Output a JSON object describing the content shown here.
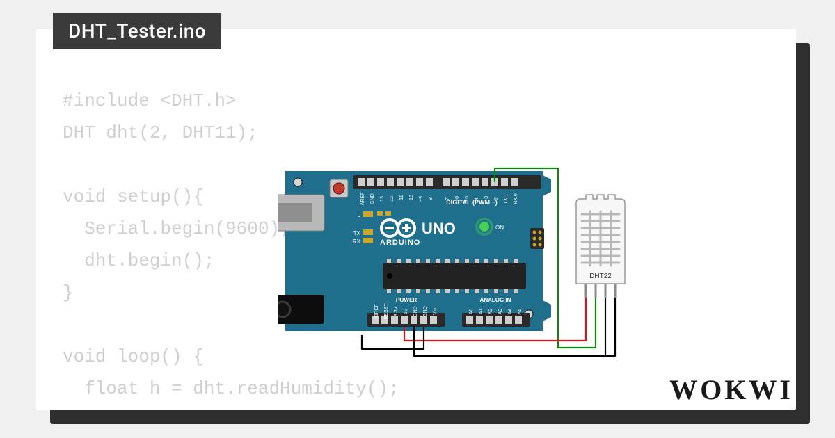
{
  "tab": {
    "filename": "DHT_Tester.ino"
  },
  "code": {
    "lines": [
      "#include <DHT.h>",
      "DHT dht(2, DHT11);",
      "",
      "void setup(){",
      "  Serial.begin(9600);",
      "  dht.begin();",
      "}",
      "",
      "void loop() {",
      "  float h = dht.readHumidity();"
    ]
  },
  "board": {
    "name": "UNO",
    "brand": "ARDUINO",
    "section_digital": "DIGITAL (PWM ~)",
    "section_analog": "ANALOG IN",
    "section_power": "POWER",
    "label_on": "ON",
    "label_l": "L",
    "label_tx": "TX",
    "label_rx": "RX",
    "pins_digital": [
      "AREF",
      "GND",
      "13",
      "12",
      "~11",
      "~10",
      "~9",
      "8",
      "7",
      "~6",
      "~5",
      "4",
      "~3",
      "2",
      "TX 1",
      "RX 0"
    ],
    "pins_power": [
      "IOREF",
      "RESET",
      "3.3V",
      "5V",
      "GND",
      "GND",
      "Vin"
    ],
    "pins_analog": [
      "A0",
      "A1",
      "A2",
      "A3",
      "A4",
      "A5"
    ]
  },
  "sensor": {
    "label": "DHT22"
  },
  "wiring": {
    "connections": [
      {
        "color": "#d11",
        "from": "arduino_5V",
        "to": "dht_VCC"
      },
      {
        "color": "#0a0",
        "from": "arduino_D2",
        "to": "dht_DATA"
      },
      {
        "color": "#000",
        "from": "arduino_GND",
        "to": "dht_NC_and_GND"
      }
    ]
  },
  "brand": {
    "name": "WOKWI"
  },
  "colors": {
    "board_pcb": "#1f6e8c",
    "board_silk": "#ffffff",
    "header": "#2a2a2a",
    "chip": "#222222",
    "usb": "#b8b8b8",
    "barrel": "#0d0d0d",
    "led_on": "#4be04b",
    "reset_btn": "#c0392b",
    "sensor_body": "#f4f4f4",
    "sensor_stroke": "#9a9a9a"
  }
}
